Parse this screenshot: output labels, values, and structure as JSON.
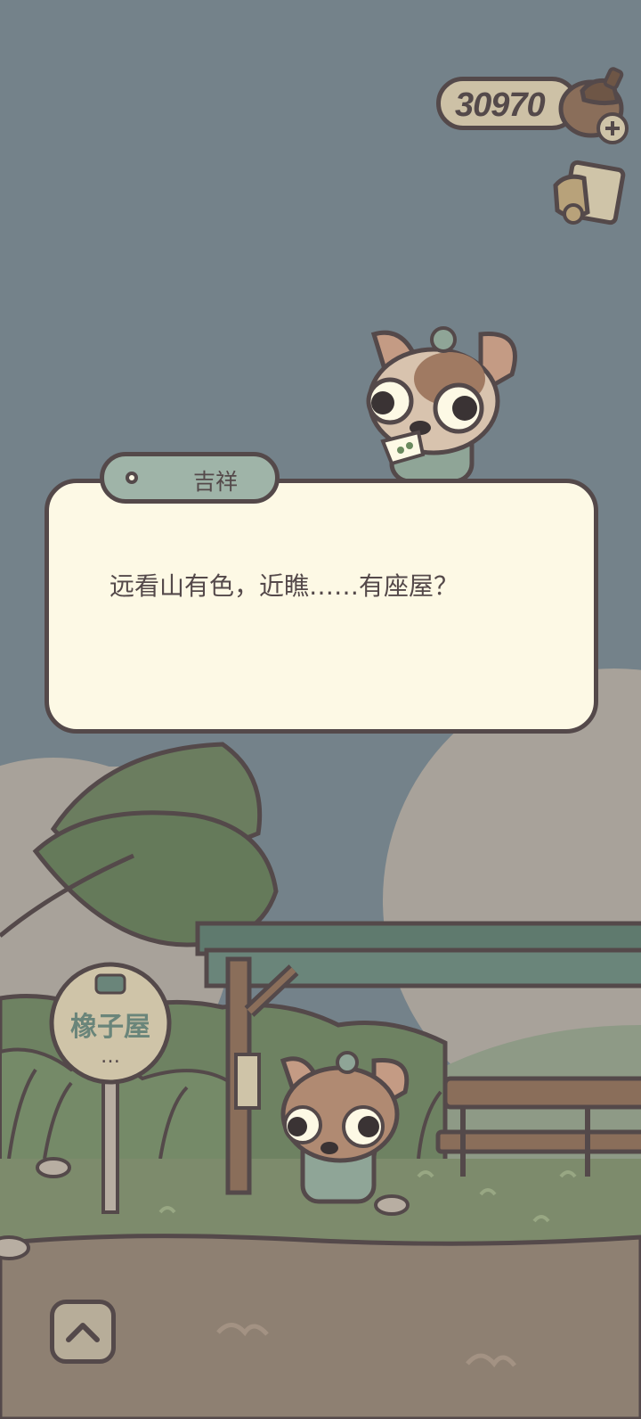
{
  "hud": {
    "acorn_count": "30970",
    "acorn_icon": "acorn-plus-icon",
    "album_icon": "photo-album-icon"
  },
  "dialog": {
    "speaker": "吉祥",
    "text": "远看山有色，近瞧……有座屋？"
  },
  "scene": {
    "bus_stop_sign_text": "橡子屋",
    "bus_stop_sign_icon": "bus-icon",
    "bus_stop_sign_dots": "…"
  },
  "controls": {
    "expand_icon": "chevron-up-icon"
  },
  "colors": {
    "sky": "#74828a",
    "outline": "#54494a",
    "dialog_bg": "#fdf9e5",
    "nametag_bg": "#9fb4a8",
    "ground": "#8e8072",
    "grass": "#7d8b6c",
    "foliage": "#5e7358"
  }
}
